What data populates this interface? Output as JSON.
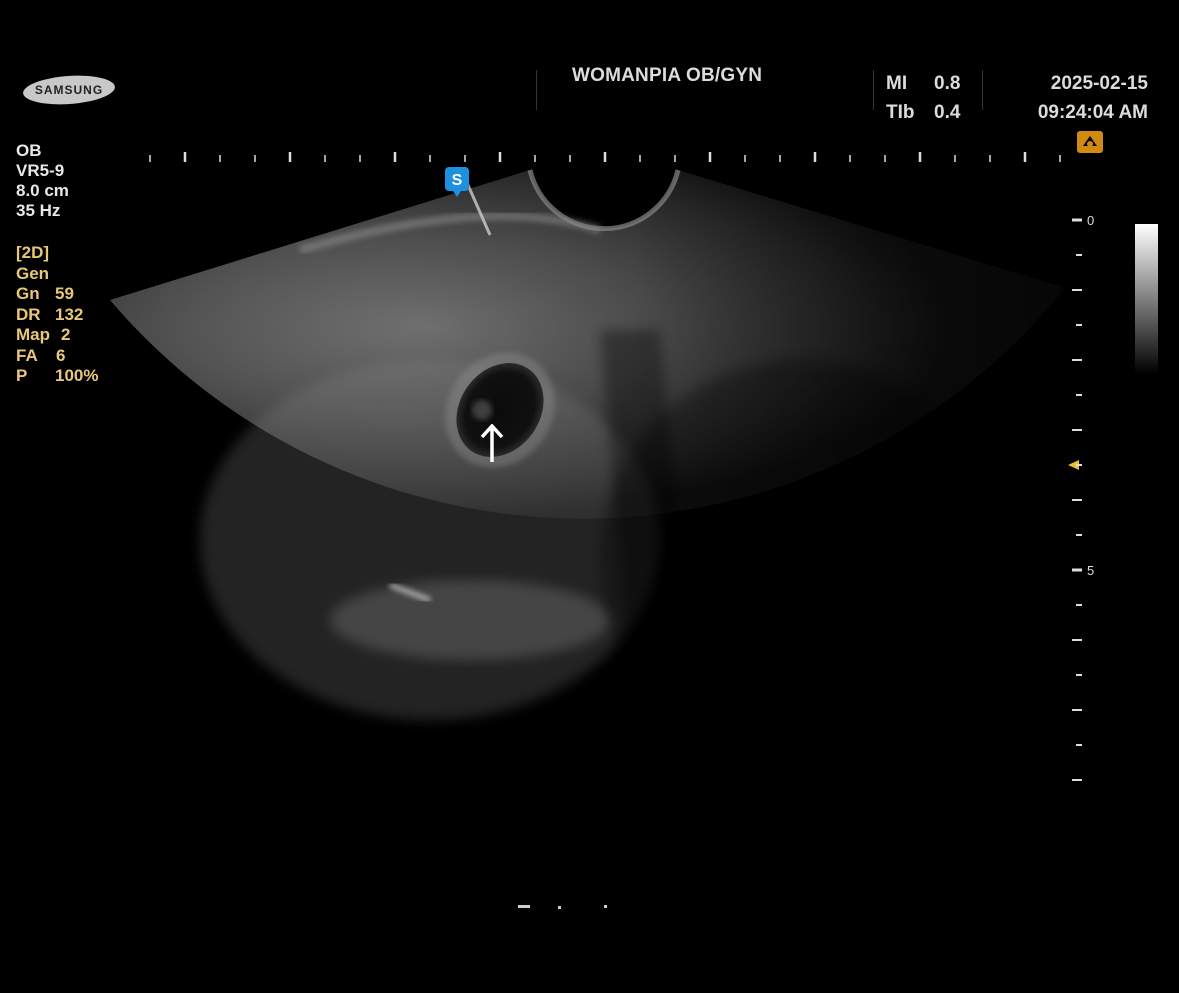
{
  "brand": {
    "logo_text": "SAMSUNG"
  },
  "header": {
    "clinic_name": "WOMANPIA OB/GYN",
    "mi_label": "MI",
    "mi_value": "0.8",
    "tib_label": "TIb",
    "tib_value": "0.4",
    "date": "2025-02-15",
    "time": "09:24:04 AM"
  },
  "exam_info": {
    "preset": "OB",
    "probe": "VR5-9",
    "depth": "8.0 cm",
    "frame_rate": "35 Hz"
  },
  "imaging_params": {
    "mode": "[2D]",
    "freq": "Gen",
    "gain_label": "Gn",
    "gain_value": "59",
    "dr_label": "DR",
    "dr_value": "132",
    "map_label": "Map",
    "map_value": "2",
    "fa_label": "FA",
    "fa_value": "6",
    "power_label": "P",
    "power_value": "100%"
  },
  "depth_scale": {
    "label_0": "0",
    "label_5": "5"
  },
  "markers": {
    "orientation_marker": "S",
    "arrow_icon": "up-arrow-icon",
    "probe_icon": "probe-icon"
  },
  "colors": {
    "param_yellow": "#e8c878",
    "text_white": "#e8e8e8",
    "marker_blue": "#1e90e0",
    "icon_orange": "#d08a10"
  }
}
